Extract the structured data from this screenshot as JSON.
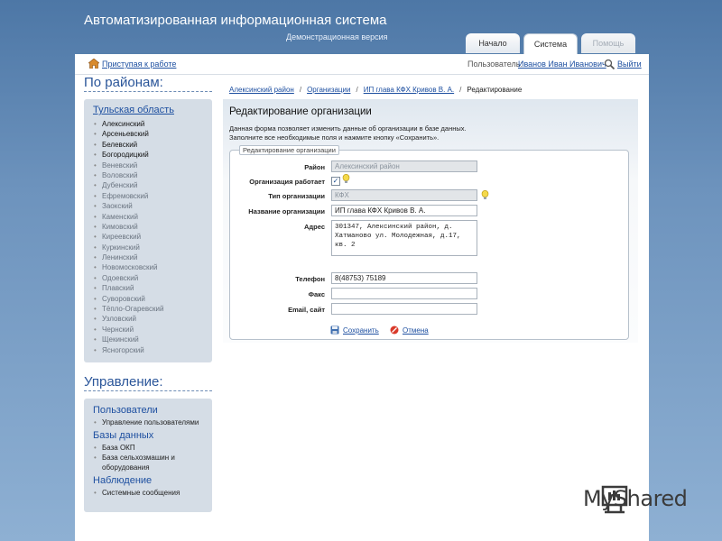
{
  "header": {
    "title": "Автоматизированная информационная система",
    "subtitle": "Демонстрационная версия",
    "tabs": [
      {
        "label": "Начало",
        "state": "normal"
      },
      {
        "label": "Система",
        "state": "active"
      },
      {
        "label": "Помощь",
        "state": "disabled"
      }
    ]
  },
  "topbar": {
    "home_icon": "home-icon",
    "home_link": "Приступая к работе",
    "user_label": "Пользователь:",
    "user_name": "Иванов Иван Иванович",
    "exit_icon": "exit-icon",
    "exit_label": "Выйти"
  },
  "sidebar": {
    "regions_title": "По районам:",
    "region_name": "Тульская область",
    "districts": [
      {
        "name": "Алексинский",
        "enabled": true
      },
      {
        "name": "Арсеньевский",
        "enabled": true
      },
      {
        "name": "Белевский",
        "enabled": true
      },
      {
        "name": "Богородицкий",
        "enabled": true
      },
      {
        "name": "Веневский",
        "enabled": false
      },
      {
        "name": "Воловский",
        "enabled": false
      },
      {
        "name": "Дубенский",
        "enabled": false
      },
      {
        "name": "Ефремовский",
        "enabled": false
      },
      {
        "name": "Заокский",
        "enabled": false
      },
      {
        "name": "Каменский",
        "enabled": false
      },
      {
        "name": "Кимовский",
        "enabled": false
      },
      {
        "name": "Киреевский",
        "enabled": false
      },
      {
        "name": "Куркинский",
        "enabled": false
      },
      {
        "name": "Ленинский",
        "enabled": false
      },
      {
        "name": "Новомосковский",
        "enabled": false
      },
      {
        "name": "Одоевский",
        "enabled": false
      },
      {
        "name": "Плавский",
        "enabled": false
      },
      {
        "name": "Суворовский",
        "enabled": false
      },
      {
        "name": "Тёпло-Огаревский",
        "enabled": false
      },
      {
        "name": "Узловский",
        "enabled": false
      },
      {
        "name": "Чернский",
        "enabled": false
      },
      {
        "name": "Щекинский",
        "enabled": false
      },
      {
        "name": "Ясногорский",
        "enabled": false
      }
    ],
    "management_title": "Управление:",
    "management": [
      {
        "heading": "Пользователи",
        "items": [
          "Управление пользователями"
        ]
      },
      {
        "heading": "Базы данных",
        "items": [
          "База ОКП",
          "База сельхозмашин и оборудования"
        ]
      },
      {
        "heading": "Наблюдение",
        "items": [
          "Системные сообщения"
        ]
      }
    ]
  },
  "breadcrumb": {
    "items": [
      "Алексинский район",
      "Организации",
      "ИП глава КФХ Кривов В. А."
    ],
    "current": "Редактирование",
    "separator": "/"
  },
  "content": {
    "title": "Редактирование организации",
    "description": "Данная форма позволяет изменить данные об организации в базе данных. Заполните все необходимые поля и нажмите кнопку «Сохранить».",
    "legend": "Редактирование организации",
    "fields": {
      "district": {
        "label": "Район",
        "value": "Алексинский район"
      },
      "active": {
        "label": "Организация работает",
        "checked": "✓"
      },
      "org_type": {
        "label": "Тип организации",
        "value": "КФХ"
      },
      "org_name": {
        "label": "Название организации",
        "value": "ИП глава КФХ Кривов В. А."
      },
      "address": {
        "label": "Адрес",
        "value": "301347, Алексинский район, д. Хатманово ул. Молодежная, д.17, кв. 2"
      },
      "phone": {
        "label": "Телефон",
        "value": "8(48753) 75189"
      },
      "fax": {
        "label": "Факс",
        "value": ""
      },
      "email": {
        "label": "Email, сайт",
        "value": ""
      }
    },
    "save_label": "Сохранить",
    "cancel_label": "Отмена",
    "hint_icon": "lightbulb-icon"
  },
  "watermark": {
    "text": "MyShared"
  },
  "colors": {
    "link": "#1d4fa0",
    "background_top": "#4d77a6",
    "panel": "#d5dde6"
  }
}
